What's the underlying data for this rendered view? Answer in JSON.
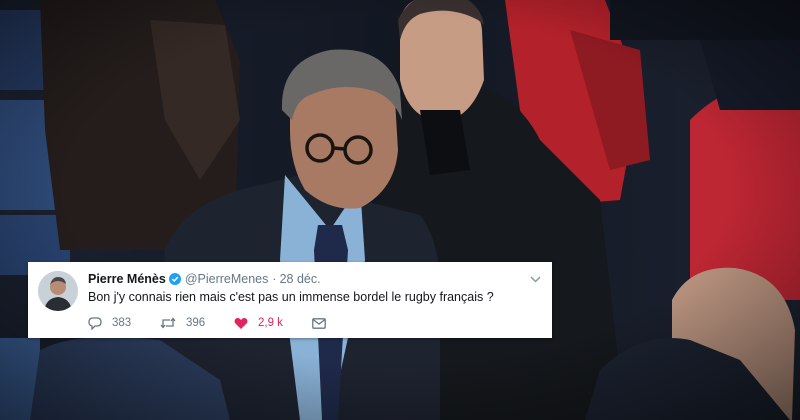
{
  "tweet": {
    "display_name": "Pierre Ménès",
    "handle": "@PierreMenes",
    "separator": "·",
    "date": "28 déc.",
    "text": "Bon j'y connais rien mais c'est pas un immense bordel le rugby français ?",
    "replies": "383",
    "retweets": "396",
    "likes": "2,9 k"
  },
  "colors": {
    "verified": "#1da1f2",
    "like": "#e0245e",
    "secondary_text": "#657786",
    "primary_text": "#14171a"
  },
  "icons": {
    "verified": "verified-badge-icon",
    "caret": "chevron-down-icon",
    "reply": "reply-icon",
    "retweet": "retweet-icon",
    "like": "heart-icon",
    "message": "direct-message-icon"
  }
}
